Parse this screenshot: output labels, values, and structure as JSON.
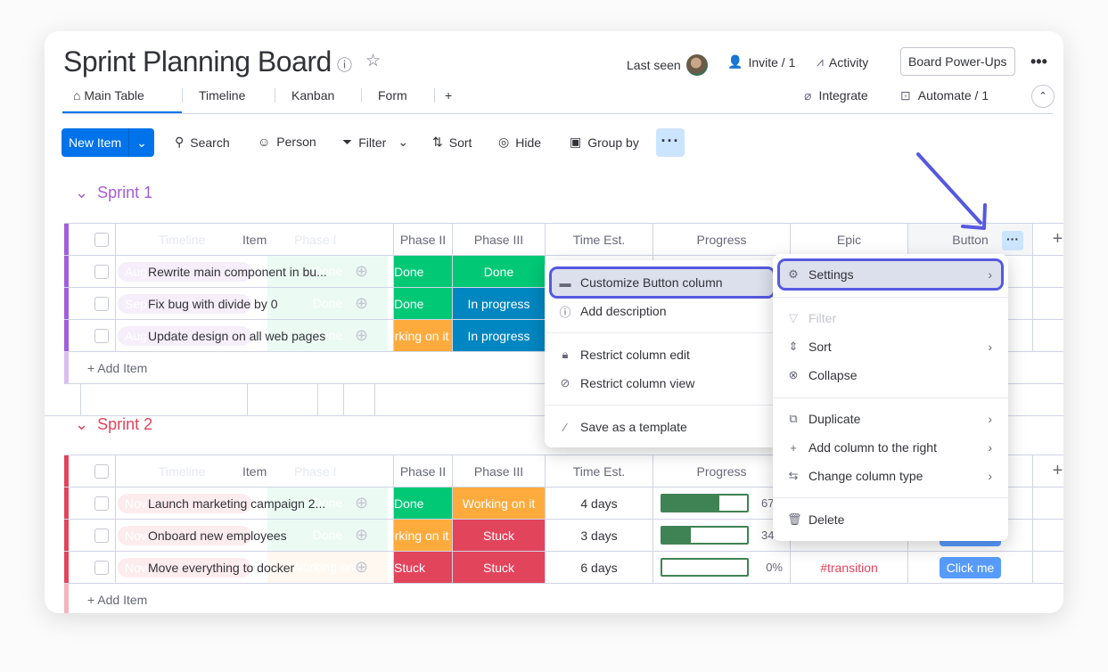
{
  "header": {
    "title": "Sprint Planning Board",
    "last_seen": "Last seen",
    "invite": "Invite / 1",
    "activity": "Activity",
    "power_ups": "Board Power-Ups",
    "integrate": "Integrate",
    "automate": "Automate / 1"
  },
  "tabs": [
    "Main Table",
    "Timeline",
    "Kanban",
    "Form",
    "+"
  ],
  "toolbar": {
    "new_item": "New Item",
    "search": "Search",
    "person": "Person",
    "filter": "Filter",
    "sort": "Sort",
    "hide": "Hide",
    "group_by": "Group by"
  },
  "columns": {
    "timeline": "Timeline",
    "item": "Item",
    "phase1": "Phase I",
    "phase2": "Phase II",
    "phase3": "Phase III",
    "time_est": "Time Est.",
    "progress": "Progress",
    "epic": "Epic",
    "button": "Button"
  },
  "groups": [
    {
      "title": "Sprint 1",
      "color": "#a25ddc",
      "add_item": "+ Add Item",
      "rows": [
        {
          "date": "Aug",
          "item": "Rewrite main component in bu...",
          "phase1": "Done",
          "phase2": "Done",
          "phase3": "Done"
        },
        {
          "date": "Sep",
          "item": "Fix bug with divide by 0",
          "phase1": "Done",
          "phase2": "Done",
          "phase3": "In progress"
        },
        {
          "date": "Aug",
          "item": "Update design on all web pages",
          "phase1": "Done",
          "phase2": "Working on it",
          "phase3": "In progress"
        }
      ]
    },
    {
      "title": "Sprint 2",
      "color": "#e2445c",
      "add_item": "+ Add Item",
      "rows": [
        {
          "date": "Nov",
          "item": "Launch marketing campaign 2...",
          "phase1": "Done",
          "phase2": "Done",
          "phase3": "Working on it",
          "time": "4 days",
          "progress": 67,
          "progress_label": "67%",
          "epic": "",
          "button": ""
        },
        {
          "date": "Nov",
          "item": "Onboard new employees",
          "phase1": "Done",
          "phase2": "Working on it",
          "phase3": "Stuck",
          "time": "3 days",
          "progress": 34,
          "progress_label": "34%",
          "epic": "",
          "button": "Click me"
        },
        {
          "date": "Nov",
          "item": "Move everything to docker",
          "phase1": "Working on it",
          "phase2": "Stuck",
          "phase3": "Stuck",
          "time": "6 days",
          "progress": 0,
          "progress_label": "0%",
          "epic": "#transition",
          "button": "Click me"
        }
      ]
    }
  ],
  "status_colors": {
    "Done": "#00c875",
    "In progress": "#0086c0",
    "Working on it": "#fdab3d",
    "Stuck": "#e2445c"
  },
  "menu_settings": {
    "customize": "Customize Button column",
    "add_description": "Add description",
    "restrict_edit": "Restrict column edit",
    "restrict_view": "Restrict column view",
    "save_template": "Save as a template"
  },
  "menu_column": {
    "settings": "Settings",
    "filter": "Filter",
    "sort": "Sort",
    "collapse": "Collapse",
    "duplicate": "Duplicate",
    "add_right": "Add column to the right",
    "change_type": "Change column type",
    "delete": "Delete"
  },
  "highlight_color": "#5559df"
}
